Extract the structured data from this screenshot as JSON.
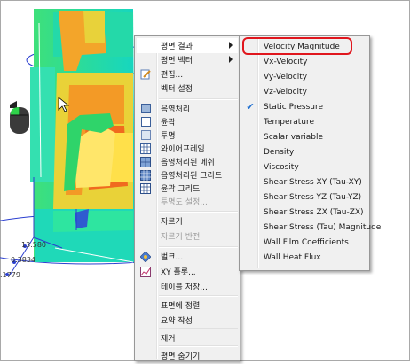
{
  "axis": {
    "tick_a": "13.580",
    "tick_b": "0.3834",
    "tick_c": ".1779"
  },
  "main_menu": {
    "items": [
      {
        "label": "평면 결과",
        "has_submenu": true,
        "disabled": false
      },
      {
        "label": "평면 벡터",
        "has_submenu": true,
        "disabled": false
      },
      {
        "label": "편집...",
        "disabled": false
      },
      {
        "label": "벡터 설정",
        "disabled": false
      },
      {
        "label": "음영처리",
        "disabled": false
      },
      {
        "label": "윤곽",
        "disabled": false
      },
      {
        "label": "투명",
        "disabled": false
      },
      {
        "label": "와이어프레임",
        "disabled": false
      },
      {
        "label": "음영처리된 메쉬",
        "disabled": false
      },
      {
        "label": "음영처리된 그리드",
        "disabled": false
      },
      {
        "label": "윤곽 그리드",
        "disabled": false
      },
      {
        "label": "투명도 설정...",
        "disabled": true
      },
      {
        "label": "자르기",
        "disabled": false
      },
      {
        "label": "자르기 반전",
        "disabled": true
      },
      {
        "label": "벌크...",
        "disabled": false
      },
      {
        "label": "XY 플롯...",
        "disabled": false
      },
      {
        "label": "테이블 저장...",
        "disabled": false
      },
      {
        "label": "표면에 정렬",
        "disabled": false
      },
      {
        "label": "요약 작성",
        "disabled": false
      },
      {
        "label": "제거",
        "disabled": false
      },
      {
        "label": "평면 숨기기",
        "disabled": false
      }
    ]
  },
  "sub_menu": {
    "items": [
      {
        "label": "Velocity Magnitude",
        "checked": false
      },
      {
        "label": "Vx-Velocity",
        "checked": false
      },
      {
        "label": "Vy-Velocity",
        "checked": false
      },
      {
        "label": "Vz-Velocity",
        "checked": false
      },
      {
        "label": "Static Pressure",
        "checked": true
      },
      {
        "label": "Temperature",
        "checked": false
      },
      {
        "label": "Scalar variable",
        "checked": false
      },
      {
        "label": "Density",
        "checked": false
      },
      {
        "label": "Viscosity",
        "checked": false
      },
      {
        "label": "Shear Stress XY (Tau-XY)",
        "checked": false
      },
      {
        "label": "Shear Stress YZ (Tau-YZ)",
        "checked": false
      },
      {
        "label": "Shear Stress ZX (Tau-ZX)",
        "checked": false
      },
      {
        "label": "Shear Stress (Tau) Magnitude",
        "checked": false
      },
      {
        "label": "Wall Film Coefficients",
        "checked": false
      },
      {
        "label": "Wall Heat Flux",
        "checked": false
      }
    ]
  },
  "colors": {
    "highlight_ring": "#e0161d",
    "check_mark": "#1f6fd0"
  }
}
